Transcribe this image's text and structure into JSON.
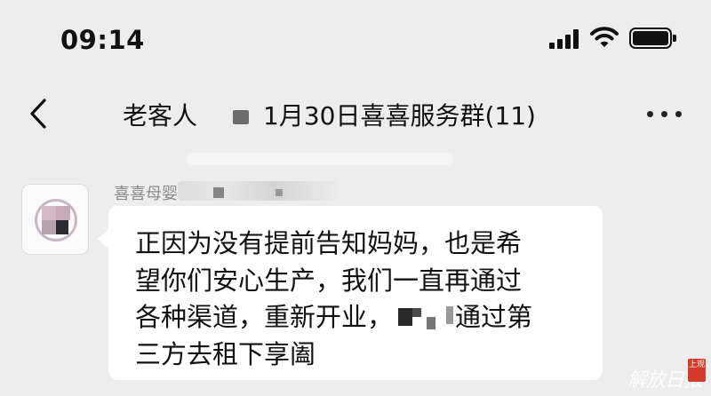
{
  "status_bar": {
    "time": "09:14",
    "icons": [
      "signal-icon",
      "wifi-icon",
      "battery-icon"
    ]
  },
  "nav": {
    "back_icon": "chevron-left-icon",
    "title_prefix": "老客人",
    "title_main": "1月30日喜喜服务群(11)",
    "more_icon": "more-dots-icon"
  },
  "message": {
    "sender": "喜喜母婴",
    "lines": [
      "正因为没有提前告知妈妈，也是希",
      "望你们安心生产，我们一直再通过",
      "各种渠道，重新开业，",
      "三方去租下享阖"
    ],
    "line3_suffix": "通过第"
  },
  "watermark": {
    "text": "解放日报",
    "seal": "上观"
  },
  "colors": {
    "background": "#ededed",
    "bubble": "#ffffff",
    "sender_text": "#8a8a8a"
  }
}
